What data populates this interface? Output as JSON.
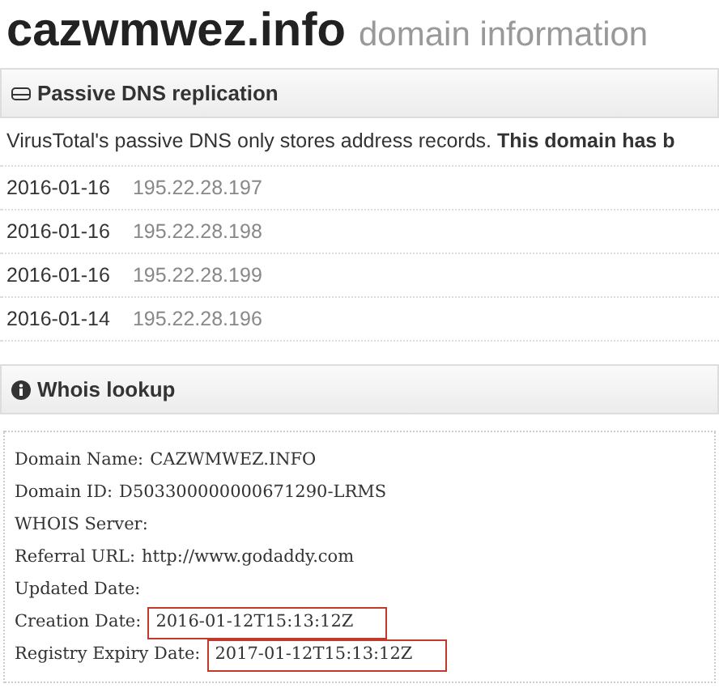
{
  "title": {
    "domain": "cazwmwez.info",
    "subtitle": "domain information"
  },
  "passive_dns": {
    "heading": "Passive DNS replication",
    "note": "VirusTotal's passive DNS only stores address records. **This domain has b**",
    "rows": [
      {
        "date": "2016-01-16",
        "ip": "195.22.28.197"
      },
      {
        "date": "2016-01-16",
        "ip": "195.22.28.198"
      },
      {
        "date": "2016-01-16",
        "ip": "195.22.28.199"
      },
      {
        "date": "2016-01-14",
        "ip": "195.22.28.196"
      }
    ]
  },
  "whois": {
    "heading": "Whois lookup",
    "lines": [
      {
        "label": "Domain Name:",
        "value": "CAZWMWEZ.INFO",
        "highlighted": false
      },
      {
        "label": "Domain ID:",
        "value": "D503300000000671290-LRMS",
        "highlighted": false
      },
      {
        "label": "WHOIS Server:",
        "highlighted": false
      },
      {
        "label": "Referral URL:",
        "value": "http://www.godaddy.com",
        "highlighted": false
      },
      {
        "label": "Updated Date:",
        "highlighted": false
      },
      {
        "label": "Creation Date:",
        "value": "2016-01-12T15:13:12Z",
        "highlighted": true
      },
      {
        "label": "Registry Expiry Date:",
        "value": "2017-01-12T15:13:12Z",
        "highlighted": true
      }
    ]
  }
}
